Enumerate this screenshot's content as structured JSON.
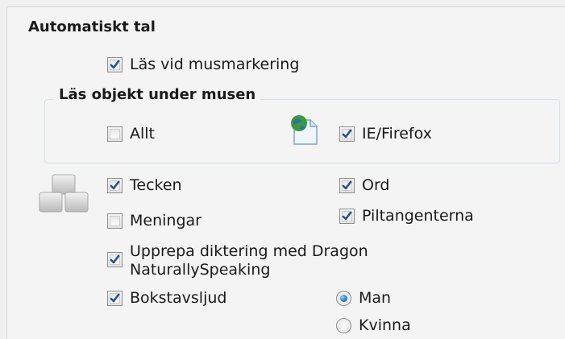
{
  "section_title": "Automatiskt tal",
  "read_on_hover": {
    "label": "Läs vid musmarkering",
    "checked": true
  },
  "group": {
    "title": "Läs objekt under musen",
    "all": {
      "label": "Allt",
      "checked": false
    },
    "browser": {
      "label": "IE/Firefox",
      "checked": true
    }
  },
  "options": {
    "characters": {
      "label": "Tecken",
      "checked": true
    },
    "words": {
      "label": "Ord",
      "checked": true
    },
    "sentences": {
      "label": "Meningar",
      "checked": false
    },
    "arrow_keys": {
      "label": "Piltangenterna",
      "checked": true
    },
    "dragon": {
      "label_line1": "Upprepa diktering med Dragon",
      "label_line2": "NaturallySpeaking",
      "checked": true
    },
    "letter_sound": {
      "label": "Bokstavsljud",
      "checked": true
    }
  },
  "voice": {
    "male": {
      "label": "Man",
      "selected": true
    },
    "female": {
      "label": "Kvinna",
      "selected": false
    }
  },
  "icons": {
    "browser": "globe-document-icon",
    "keyboard": "keyboard-keys-icon"
  },
  "colors": {
    "check_blue": "#2a4f8f"
  }
}
